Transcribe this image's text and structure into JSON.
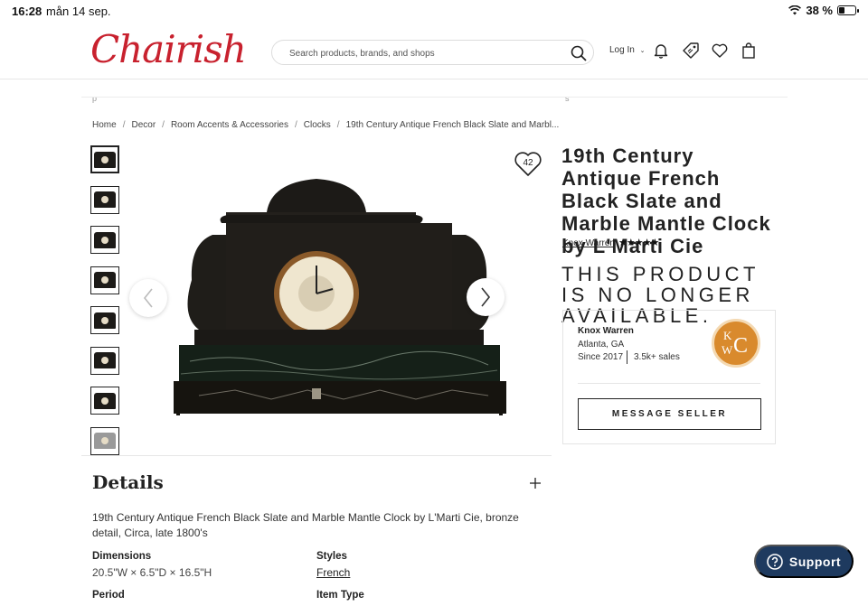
{
  "status_bar": {
    "time": "16:28",
    "date": "mån 14 sep.",
    "battery": "38 %",
    "battery_level": 0.38
  },
  "header": {
    "logo": "Chairish",
    "search_placeholder": "Search products, brands, and shops",
    "login": "Log In",
    "clipped_left": "p",
    "clipped_right": "s"
  },
  "breadcrumb": [
    "Home",
    "Decor",
    "Room Accents & Accessories",
    "Clocks",
    "19th Century Antique French Black Slate and Marbl..."
  ],
  "gallery": {
    "favorite_count": "42",
    "thumbnail_count": 8
  },
  "product": {
    "title": "19th Century Antique French Black Slate and Marble Mantle Clock by L'Marti Cie",
    "shop": "Knox Warren",
    "rating_stars": "★★★★★",
    "rating": 5,
    "unavailable": "THIS PRODUCT IS NO LONGER AVAILABLE."
  },
  "seller": {
    "name": "Knox Warren",
    "location": "Atlanta, GA",
    "since": "Since 2017",
    "sales": "3.5k+ sales",
    "logo_text": "KWC",
    "message_button": "MESSAGE SELLER"
  },
  "details": {
    "heading": "Details",
    "description": "19th Century Antique French Black Slate and Marble Mantle Clock by L'Marti Cie, bronze detail, Circa, late 1800's",
    "dimensions_label": "Dimensions",
    "dimensions_value": "20.5\"W × 6.5\"D × 16.5\"H",
    "styles_label": "Styles",
    "styles_value": "French",
    "period_label": "Period",
    "item_type_label": "Item Type"
  },
  "support": {
    "label": "Support"
  },
  "colors": {
    "brand_red": "#c8212e",
    "support_navy": "#1e3a5f",
    "seller_logo": "#d98a2d"
  }
}
